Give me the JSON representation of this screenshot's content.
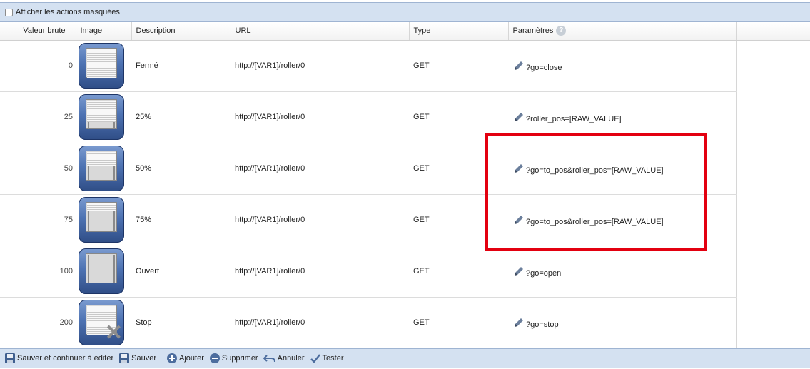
{
  "top": {
    "show_hidden_label": "Afficher les actions masquées"
  },
  "columns": {
    "raw": "Valeur brute",
    "image": "Image",
    "description": "Description",
    "url": "URL",
    "type": "Type",
    "params": "Paramètres"
  },
  "rows": [
    {
      "raw": "0",
      "image": "shutter-closed-icon",
      "shutter_level": 1.0,
      "description": "Fermé",
      "url": "http://[VAR1]/roller/0",
      "type": "GET",
      "params": "?go=close"
    },
    {
      "raw": "25",
      "image": "shutter-25-icon",
      "shutter_level": 0.75,
      "description": "25%",
      "url": "http://[VAR1]/roller/0",
      "type": "GET",
      "params": "?roller_pos=[RAW_VALUE]"
    },
    {
      "raw": "50",
      "image": "shutter-50-icon",
      "shutter_level": 0.5,
      "description": "50%",
      "url": "http://[VAR1]/roller/0",
      "type": "GET",
      "params": "?go=to_pos&roller_pos=[RAW_VALUE]"
    },
    {
      "raw": "75",
      "image": "shutter-75-icon",
      "shutter_level": 0.25,
      "description": "75%",
      "url": "http://[VAR1]/roller/0",
      "type": "GET",
      "params": "?go=to_pos&roller_pos=[RAW_VALUE]"
    },
    {
      "raw": "100",
      "image": "shutter-open-icon",
      "shutter_level": 0.0,
      "description": "Ouvert",
      "url": "http://[VAR1]/roller/0",
      "type": "GET",
      "params": "?go=open"
    },
    {
      "raw": "200",
      "image": "shutter-stop-icon",
      "shutter_level": 1.0,
      "description": "Stop",
      "url": "http://[VAR1]/roller/0",
      "type": "GET",
      "params": "?go=stop"
    }
  ],
  "toolbar": {
    "save_continue": "Sauver et continuer à éditer",
    "save": "Sauver",
    "add": "Ajouter",
    "delete": "Supprimer",
    "cancel": "Annuler",
    "test": "Tester"
  },
  "colors": {
    "bar_background": "#d4e1f1",
    "highlight_border": "#e30010",
    "tile_blue": "#4e73b3"
  }
}
